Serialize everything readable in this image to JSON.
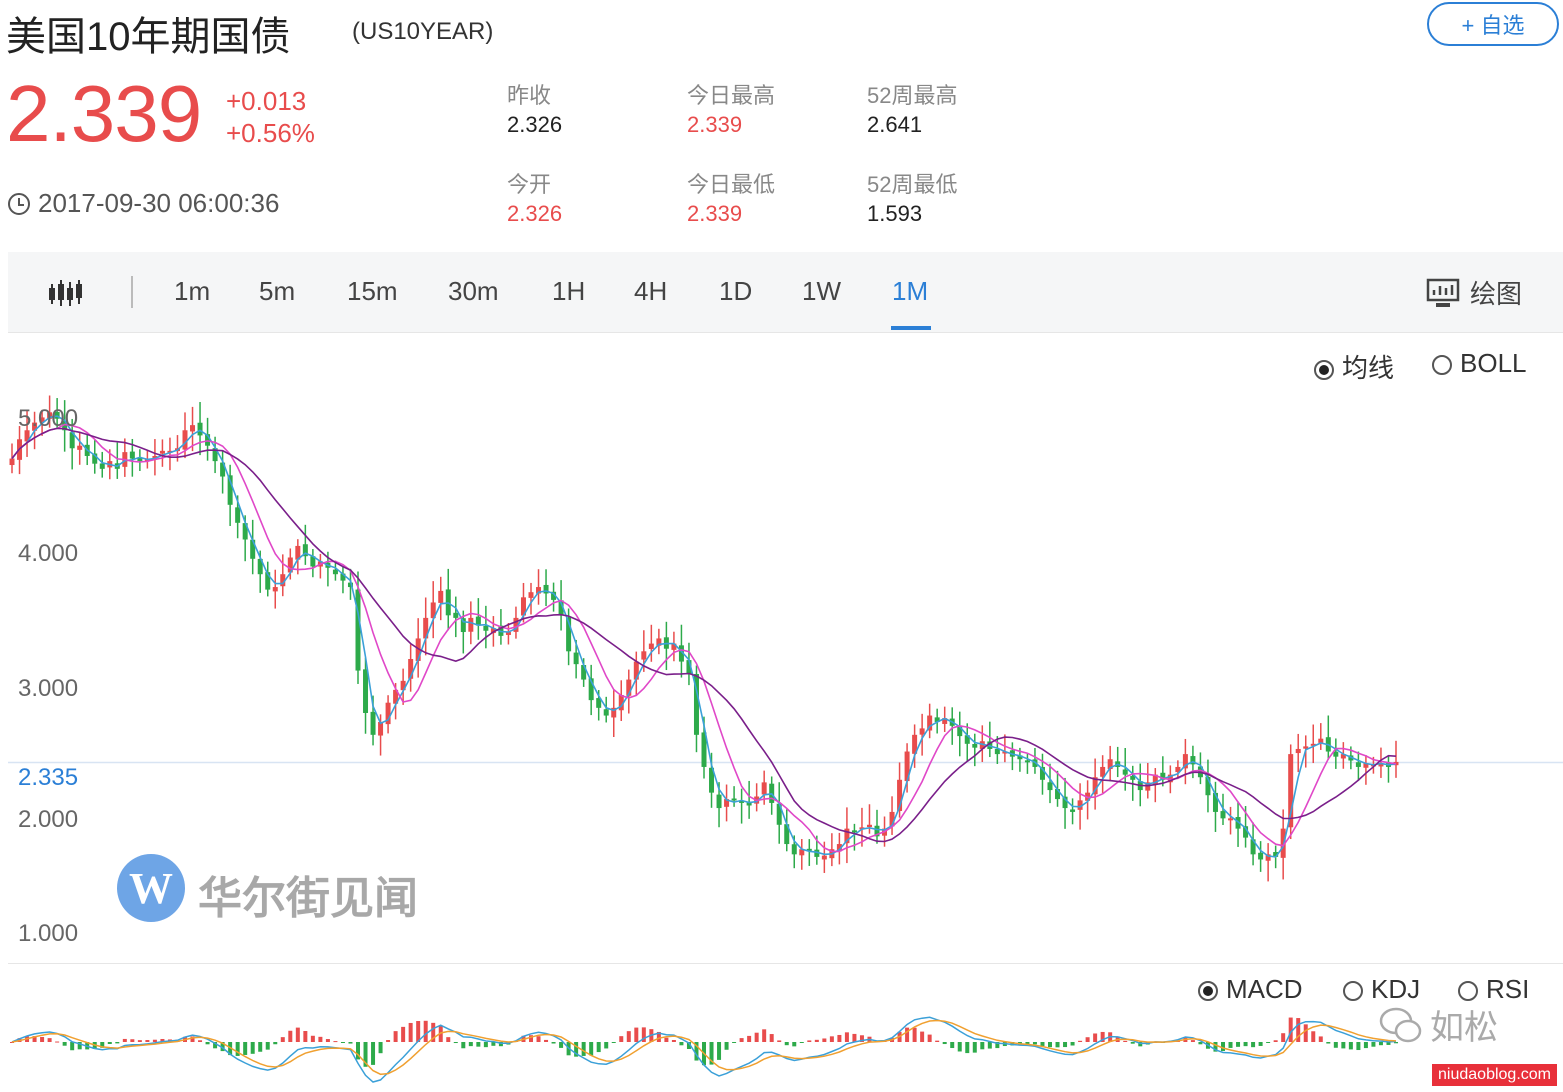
{
  "header": {
    "title": "美国10年期国债",
    "symbol": "(US10YEAR)",
    "watch_button": "+ 自选"
  },
  "quote": {
    "price": "2.339",
    "change_abs": "+0.013",
    "change_pct": "+0.56%",
    "timestamp": "2017-09-30 06:00:36"
  },
  "stats": {
    "prev_close_label": "昨收",
    "prev_close": "2.326",
    "open_label": "今开",
    "open": "2.326",
    "day_high_label": "今日最高",
    "day_high": "2.339",
    "day_low_label": "今日最低",
    "day_low": "2.339",
    "wk52_high_label": "52周最高",
    "wk52_high": "2.641",
    "wk52_low_label": "52周最低",
    "wk52_low": "1.593"
  },
  "toolbar": {
    "intervals": [
      "1m",
      "5m",
      "15m",
      "30m",
      "1H",
      "4H",
      "1D",
      "1W",
      "1M"
    ],
    "active_interval": "1M",
    "draw_label": "绘图",
    "candle_icon": "candlestick-icon",
    "draw_icon": "monitor-chart-icon"
  },
  "overlay": {
    "ma_label": "均线",
    "boll_label": "BOLL",
    "selected": "均线"
  },
  "indicator": {
    "macd_label": "MACD",
    "kdj_label": "KDJ",
    "rsi_label": "RSI",
    "selected": "MACD"
  },
  "watermark": {
    "text": "华尔街见闻",
    "logo_letter": "W",
    "corner_brand": "如松",
    "site": "niudaoblog.com"
  },
  "chart_data": {
    "type": "candlestick",
    "y_ticks": [
      "5.000",
      "4.000",
      "3.000",
      "2.000",
      "1.000"
    ],
    "current_level_label": "2.335",
    "current_level": 2.335,
    "ylim": [
      1.0,
      5.2
    ],
    "colors": {
      "up": "#e84c4c",
      "down": "#2daa4a",
      "ma_fast": "#3ba0d8",
      "ma_mid": "#e048c8",
      "ma_slow": "#7a1f8a",
      "dif": "#3ba0d8",
      "dea": "#f0a030",
      "current_line": "#2b7fd6"
    },
    "closes": [
      4.7,
      4.85,
      4.92,
      4.98,
      5.02,
      5.06,
      5.01,
      4.92,
      4.78,
      4.8,
      4.72,
      4.66,
      4.62,
      4.68,
      4.62,
      4.75,
      4.7,
      4.68,
      4.7,
      4.72,
      4.76,
      4.76,
      4.78,
      4.92,
      4.96,
      4.88,
      4.8,
      4.68,
      4.56,
      4.34,
      4.2,
      4.07,
      3.92,
      3.8,
      3.68,
      3.7,
      3.8,
      3.93,
      4.02,
      3.94,
      3.86,
      3.9,
      3.85,
      3.8,
      3.75,
      3.7,
      3.05,
      2.72,
      2.55,
      2.65,
      2.8,
      2.9,
      2.97,
      3.14,
      3.3,
      3.46,
      3.58,
      3.67,
      3.48,
      3.46,
      3.35,
      3.46,
      3.4,
      3.36,
      3.38,
      3.32,
      3.35,
      3.46,
      3.62,
      3.66,
      3.7,
      3.65,
      3.6,
      3.48,
      3.2,
      3.1,
      2.98,
      2.82,
      2.76,
      2.7,
      2.76,
      2.86,
      2.98,
      3.12,
      3.2,
      3.26,
      3.3,
      3.22,
      3.26,
      3.12,
      3.02,
      2.55,
      2.3,
      2.1,
      1.98,
      2.05,
      2.05,
      2.02,
      2.0,
      2.07,
      2.18,
      2.02,
      1.85,
      1.7,
      1.62,
      1.66,
      1.65,
      1.6,
      1.61,
      1.66,
      1.7,
      1.82,
      1.8,
      1.83,
      1.85,
      1.76,
      1.82,
      1.95,
      2.2,
      2.42,
      2.55,
      2.6,
      2.7,
      2.65,
      2.68,
      2.62,
      2.54,
      2.48,
      2.45,
      2.5,
      2.44,
      2.4,
      2.42,
      2.38,
      2.36,
      2.35,
      2.3,
      2.2,
      2.12,
      2.05,
      1.98,
      1.95,
      2.04,
      2.1,
      2.22,
      2.3,
      2.36,
      2.3,
      2.24,
      2.2,
      2.12,
      2.18,
      2.24,
      2.2,
      2.24,
      2.3,
      2.4,
      2.32,
      2.22,
      2.08,
      1.95,
      1.9,
      1.9,
      1.82,
      1.75,
      1.62,
      1.58,
      1.62,
      1.6,
      1.82,
      2.4,
      2.44,
      2.46,
      2.48,
      2.52,
      2.42,
      2.38,
      2.4,
      2.35,
      2.3,
      2.33,
      2.32,
      2.33,
      2.3,
      2.339
    ]
  }
}
